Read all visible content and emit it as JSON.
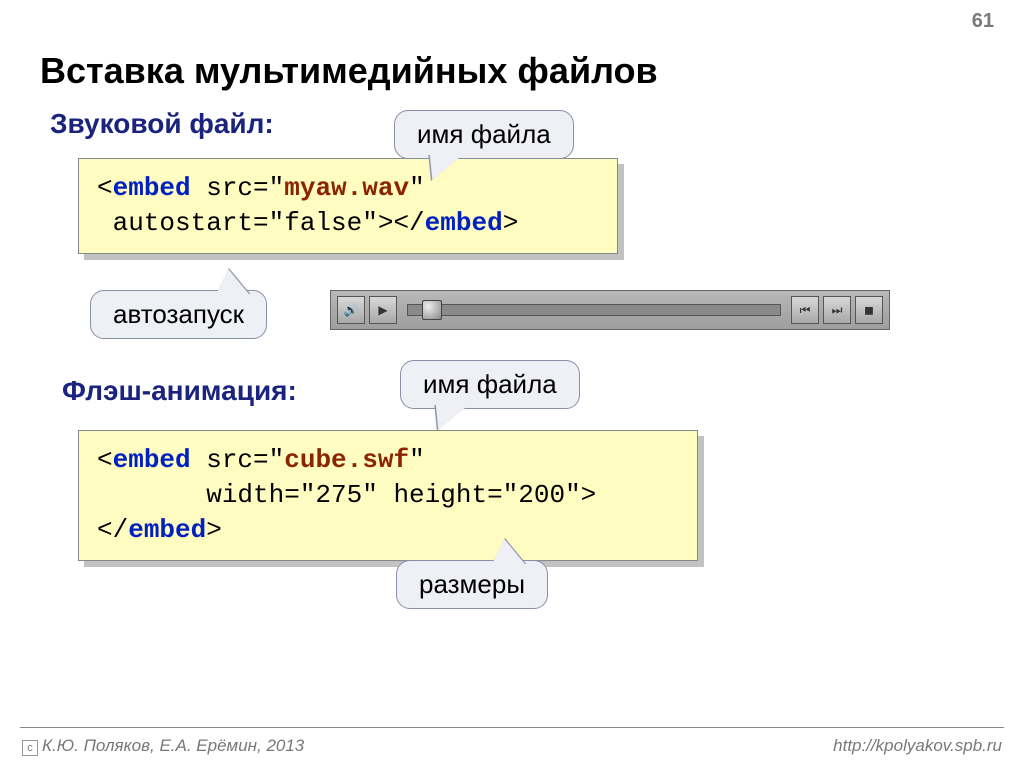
{
  "page_number": "61",
  "title": "Вставка мультимедийных файлов",
  "section1": {
    "heading": "Звуковой файл:",
    "callout_filename": "имя файла",
    "callout_autostart": "автозапуск",
    "code": {
      "open_bracket": "<",
      "tag": "embed",
      "attrs1": " src=\"",
      "file": "myaw.wav",
      "attrs2": "\"\n autostart=\"false\">",
      "close_open": "</",
      "close_tag": "embed",
      "close_end": ">"
    }
  },
  "section2": {
    "heading": "Флэш-анимация:",
    "callout_filename": "имя файла",
    "callout_size": "размеры",
    "code": {
      "open_bracket": "<",
      "tag": "embed",
      "attrs1": " src=\"",
      "file": "cube.swf",
      "attrs2": "\"\n       width=\"275\" height=\"200\">\n",
      "close_open": "</",
      "close_tag": "embed",
      "close_end": ">"
    }
  },
  "player": {
    "btn_sound": "🔊",
    "btn_play": "▶",
    "btn_prev": "⏮",
    "btn_next": "⏭",
    "btn_end": "◼"
  },
  "footer": {
    "left": "К.Ю. Поляков, Е.А. Ерёмин, 2013",
    "right": "http://kpolyakov.spb.ru",
    "copy": "c"
  }
}
